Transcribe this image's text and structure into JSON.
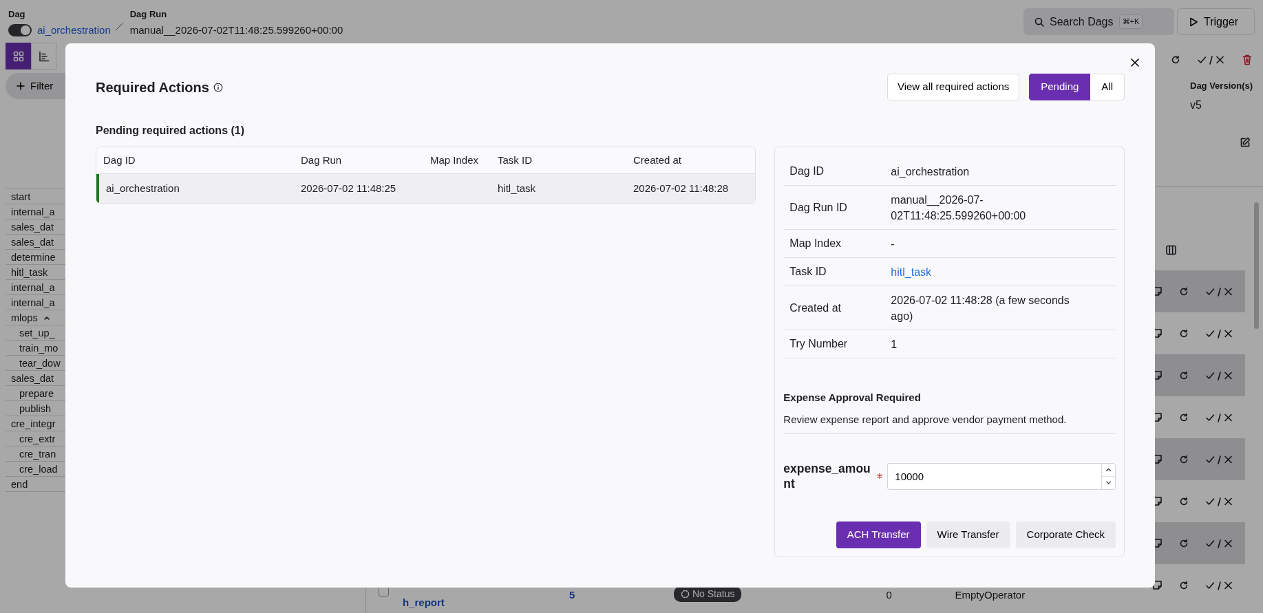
{
  "header": {
    "dag_label": "Dag",
    "dag_enabled": true,
    "dag_id": "ai_orchestration",
    "run_label": "Dag Run",
    "run_id": "manual__2026-07-02T11:48:25.599260+00:00",
    "search": {
      "label": "Search Dags",
      "shortcut": "⌘+K"
    },
    "trigger": "Trigger"
  },
  "view_buttons": [
    {
      "kind": "grid",
      "selected": true
    },
    {
      "kind": "chart",
      "selected": false
    }
  ],
  "filter_button": "Filter",
  "task_list": [
    {
      "label": "start"
    },
    {
      "label": "internal_a"
    },
    {
      "label": "sales_dat"
    },
    {
      "label": "sales_dat"
    },
    {
      "label": "determine"
    },
    {
      "label": "hitl_task"
    },
    {
      "label": "internal_a"
    },
    {
      "label": "internal_a"
    },
    {
      "label": "mlops",
      "expanded": true,
      "children": [
        {
          "label": "set_up_"
        },
        {
          "label": "train_mo"
        },
        {
          "label": "tear_dow"
        }
      ]
    },
    {
      "label": "sales_dat",
      "children": [
        {
          "label": "prepare"
        },
        {
          "label": "publish"
        }
      ]
    },
    {
      "label": "cre_integr",
      "children": [
        {
          "label": "cre_extr"
        },
        {
          "label": "cre_tran"
        },
        {
          "label": "cre_load"
        }
      ]
    },
    {
      "label": "end"
    }
  ],
  "run_details": {
    "version_label": "Dag Version(s)",
    "version": "v5"
  },
  "instance_rows": [
    {
      "shaded": true
    },
    {
      "shaded": false
    },
    {
      "shaded": true
    },
    {
      "shaded": false
    },
    {
      "shaded": true
    },
    {
      "shaded": false
    },
    {
      "shaded": true
    },
    {
      "shaded": false,
      "checked": false,
      "task_id": "h_report",
      "column_2": "5",
      "state": "No Status",
      "column_4": "0",
      "operator": "EmptyOperator"
    }
  ],
  "modal": {
    "title": "Required Actions",
    "view_all": "View all required actions",
    "filters": [
      {
        "label": "Pending",
        "selected": true
      },
      {
        "label": "All",
        "selected": false
      }
    ],
    "subtitle": "Pending required actions (1)",
    "table": {
      "columns": [
        "Dag ID",
        "Dag Run",
        "Map Index",
        "Task ID",
        "Created at"
      ],
      "rows": [
        {
          "selected": true,
          "dag_id": "ai_orchestration",
          "dag_run": "2026-07-02 11:48:25",
          "task_id": "hitl_task",
          "created_at": "2026-07-02 11:48:28"
        }
      ]
    },
    "details": [
      {
        "label": "Dag ID",
        "value": "ai_orchestration",
        "kind": "text"
      },
      {
        "label": "Dag Run ID",
        "value": "manual__2026-07-02T11:48:25.599260+00:00",
        "kind": "text"
      },
      {
        "label": "Map Index",
        "value": "-",
        "kind": "text"
      },
      {
        "label": "Task ID",
        "value": "hitl_task",
        "kind": "link"
      },
      {
        "label": "Created at",
        "value": "2026-07-02 11:48:28 (a few seconds ago)",
        "kind": "text"
      },
      {
        "label": "Try Number",
        "value": "1",
        "kind": "text"
      }
    ],
    "form_title": "Expense Approval Required",
    "form_text": "Review expense report and approve vendor payment method.",
    "field": {
      "label": "expense_amount",
      "required": true,
      "value": "10000"
    },
    "options": [
      {
        "label": "ACH Transfer",
        "selected": true
      },
      {
        "label": "Wire Transfer",
        "selected": false
      },
      {
        "label": "Corporate Check",
        "selected": false
      }
    ]
  }
}
